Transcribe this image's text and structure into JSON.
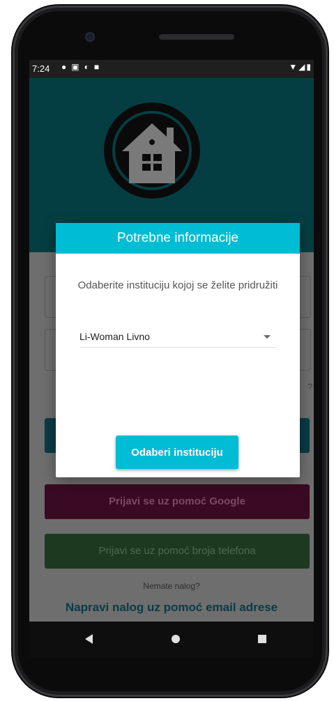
{
  "status_bar": {
    "time": "7:24",
    "icons": [
      "location-icon",
      "gmail-icon",
      "app-icon",
      "sd-card-icon"
    ],
    "right_icons": [
      "wifi-icon",
      "signal-icon",
      "battery-icon"
    ]
  },
  "background": {
    "login_google_label": "Prijavi se uz pomoć Google",
    "login_phone_label": "Prijavi se uz pomoć broja telefona",
    "no_account_text": "Nemate nalog?",
    "create_account_link": "Napravi nalog uz pomoć email adrese",
    "forgot_hint": "?"
  },
  "dialog": {
    "title": "Potrebne informacije",
    "message": "Odaberite instituciju kojoj se želite pridružiti",
    "dropdown_value": "Li-Woman Livno",
    "confirm_label": "Odaberi instituciju"
  },
  "colors": {
    "accent": "#00bcd4",
    "header": "#053e42",
    "google_button": "#3a0a22",
    "phone_button": "#1d3a20",
    "link": "#0a3b45"
  }
}
